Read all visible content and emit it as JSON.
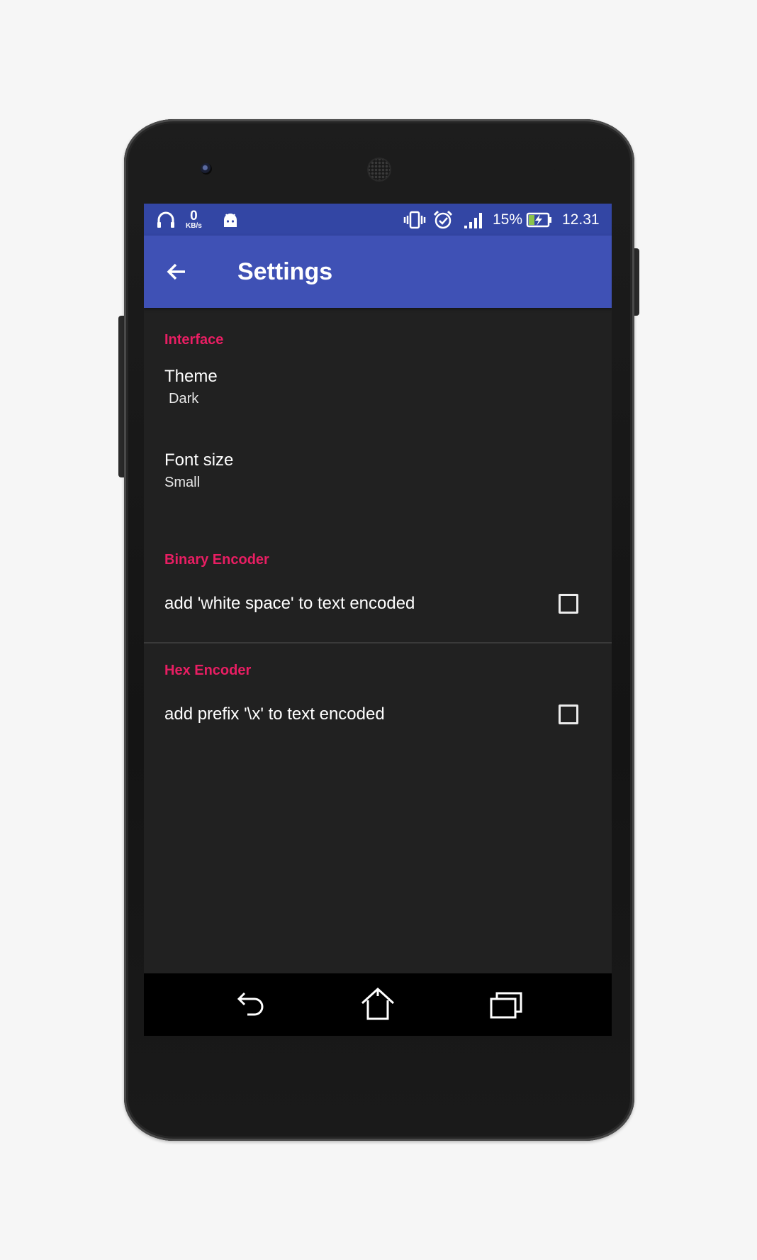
{
  "status_bar": {
    "net_speed_value": "0",
    "net_speed_unit": "KB/s",
    "battery_percent": "15%",
    "time": "12.31",
    "icons": [
      "headphones-icon",
      "android-icon",
      "vibrate-icon",
      "alarm-icon",
      "signal-icon",
      "battery-charging-icon"
    ]
  },
  "app_bar": {
    "title": "Settings",
    "back_icon": "arrow-back-icon"
  },
  "categories": {
    "interface": "Interface",
    "binary_encoder": "Binary Encoder",
    "hex_encoder": "Hex Encoder"
  },
  "prefs": {
    "theme": {
      "title": "Theme",
      "summary": "Dark"
    },
    "font_size": {
      "title": "Font size",
      "summary": "Small"
    },
    "binary_whitespace": {
      "title": "add 'white space' to text encoded",
      "checked": false
    },
    "hex_prefix": {
      "title": "add prefix '\\x' to text encoded",
      "checked": false
    }
  },
  "nav_bar": {
    "icons": [
      "back-icon",
      "home-icon",
      "recents-icon"
    ]
  },
  "colors": {
    "status_bar": "#3346a4",
    "app_bar": "#3f51b5",
    "accent": "#e91e63",
    "background": "#212121"
  }
}
